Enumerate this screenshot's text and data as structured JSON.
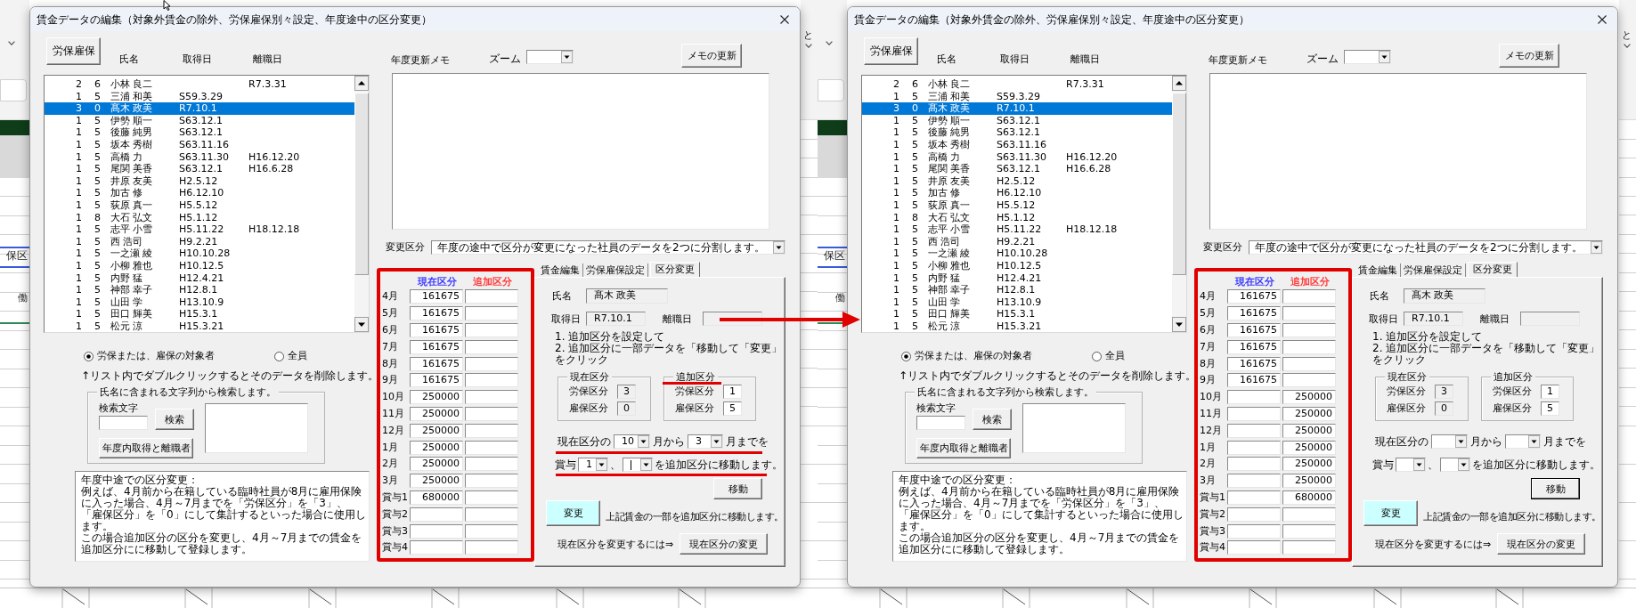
{
  "screenshots": [
    {
      "mouse_pointer": true,
      "background": {
        "left_texts": [
          "保区",
          "働"
        ],
        "right_texts": [
          "と"
        ]
      },
      "dialog": {
        "title": "賃金データの編集（対象外賃金の除外、労保雇保別々設定、年度途中の区分変更）",
        "insurance_button": "労保雇保",
        "list_columns": [
          "氏名",
          "取得日",
          "離職日"
        ],
        "employees": [
          {
            "column_1": "2",
            "column_2": "6",
            "name": "小林 良二",
            "left": "R7.3.31",
            "selected": false
          },
          {
            "column_1": "1",
            "column_2": "5",
            "name": "三浦 和美",
            "acquired": "S59.3.29",
            "selected": false
          },
          {
            "column_1": "3",
            "column_2": "0",
            "name": "髙木 政美",
            "acquired": "R7.10.1",
            "selected": true
          },
          {
            "column_1": "1",
            "column_2": "5",
            "name": "伊勢 順一",
            "acquired": "S63.12.1",
            "selected": false
          },
          {
            "column_1": "1",
            "column_2": "5",
            "name": "後藤 純男",
            "acquired": "S63.12.1",
            "selected": false
          },
          {
            "column_1": "1",
            "column_2": "5",
            "name": "坂本 秀樹",
            "acquired": "S63.11.16",
            "selected": false
          },
          {
            "column_1": "1",
            "column_2": "5",
            "name": "高橋 力",
            "acquired": "S63.11.30",
            "left": "H16.12.20",
            "selected": false
          },
          {
            "column_1": "1",
            "column_2": "5",
            "name": "尾関 美香",
            "acquired": "S63.12.1",
            "left": "H16.6.28",
            "selected": false
          },
          {
            "column_1": "1",
            "column_2": "5",
            "name": "井原 友美",
            "acquired": "H2.5.12",
            "selected": false
          },
          {
            "column_1": "1",
            "column_2": "5",
            "name": "加古 修",
            "acquired": "H6.12.10",
            "selected": false
          },
          {
            "column_1": "1",
            "column_2": "5",
            "name": "荻原 真一",
            "acquired": "H5.5.12",
            "selected": false
          },
          {
            "column_1": "1",
            "column_2": "8",
            "name": "大石 弘文",
            "acquired": "H5.1.12",
            "selected": false
          },
          {
            "column_1": "1",
            "column_2": "5",
            "name": "志平 小雪",
            "acquired": "H5.11.22",
            "left": "H18.12.18",
            "selected": false
          },
          {
            "column_1": "1",
            "column_2": "5",
            "name": "西 浩司",
            "acquired": "H9.2.21",
            "selected": false
          },
          {
            "column_1": "1",
            "column_2": "5",
            "name": "一之瀬 綾",
            "acquired": "H10.10.28",
            "selected": false
          },
          {
            "column_1": "1",
            "column_2": "5",
            "name": "小柳 雅也",
            "acquired": "H10.12.5",
            "selected": false
          },
          {
            "column_1": "1",
            "column_2": "5",
            "name": "内野 猛",
            "acquired": "H12.4.21",
            "selected": false
          },
          {
            "column_1": "1",
            "column_2": "5",
            "name": "神部 幸子",
            "acquired": "H12.8.1",
            "selected": false
          },
          {
            "column_1": "1",
            "column_2": "5",
            "name": "山田 学",
            "acquired": "H13.10.9",
            "selected": false
          },
          {
            "column_1": "1",
            "column_2": "5",
            "name": "田口 輝美",
            "acquired": "H15.3.1",
            "selected": false
          },
          {
            "column_1": "1",
            "column_2": "5",
            "name": "松元 涼",
            "acquired": "H15.3.21",
            "selected": false
          }
        ],
        "filter_options": [
          {
            "label": "労保または、雇保の対象者",
            "selected": true
          },
          {
            "label": "全員",
            "selected": false
          }
        ],
        "list_note": "↑リスト内でダブルクリックするとそのデータを削除します。",
        "search": {
          "title": "氏名に含まれる文字列から検索します。",
          "field_label": "検索文字",
          "search_button": "検索",
          "period_button": "年度内取得と離職者"
        },
        "explanation": [
          "年度中途での区分変更：",
          "例えば、4月前から在籍している臨時社員が8月に雇用保険に入った場合、4月～7月までを「労保区分」を「3」、「雇保区分」を「0」にして集計するといった場合に使用します。",
          "この場合追加区分の区分を変更し、4月～7月までの賃金を追加区分にに移動して登録します。"
        ],
        "memo_label": "年度更新メモ",
        "zoom_label": "ズーム",
        "memo_button": "メモの更新",
        "change_type": {
          "label": "変更区分",
          "value": "年度の途中で区分が変更になった社員のデータを2つに分割します。"
        },
        "month_table": {
          "highlighted": true,
          "columns": [
            {
              "label": "現在区分",
              "color": "#3c3cff"
            },
            {
              "label": "追加区分",
              "color": "#ff3c3c"
            }
          ],
          "rows": [
            {
              "label": "4月",
              "current": "161675"
            },
            {
              "label": "5月",
              "current": "161675"
            },
            {
              "label": "6月",
              "current": "161675"
            },
            {
              "label": "7月",
              "current": "161675"
            },
            {
              "label": "8月",
              "current": "161675"
            },
            {
              "label": "9月",
              "current": "161675"
            },
            {
              "label": "10月",
              "current": "250000"
            },
            {
              "label": "11月",
              "current": "250000"
            },
            {
              "label": "12月",
              "current": "250000"
            },
            {
              "label": "1月",
              "current": "250000"
            },
            {
              "label": "2月",
              "current": "250000"
            },
            {
              "label": "3月",
              "current": "250000"
            },
            {
              "label": "賞与1",
              "current": "680000"
            },
            {
              "label": "賞与2"
            },
            {
              "label": "賞与3"
            },
            {
              "label": "賞与4"
            }
          ]
        },
        "tabs": [
          {
            "label": "賃金編集",
            "selected": false
          },
          {
            "label": "労保雇保設定",
            "selected": false
          },
          {
            "label": "区分変更",
            "selected": true
          }
        ],
        "tab_page": {
          "name_field": {
            "label": "氏名",
            "value": "髙木 政美"
          },
          "acquired_field": {
            "label": "取得日",
            "value": "R7.10.1"
          },
          "left_field": {
            "label": "離職日"
          },
          "steps": [
            "1. 追加区分を設定して",
            "2. 追加区分に一部データを「移動して「変更」をクリック"
          ],
          "groups": [
            {
              "title": "現在区分",
              "underlined": false,
              "fields": [
                {
                  "label": "労保区分",
                  "value": "3",
                  "disabled": true
                },
                {
                  "label": "雇保区分",
                  "value": "0",
                  "disabled": true
                }
              ]
            },
            {
              "title": "追加区分",
              "underlined": true,
              "fields": [
                {
                  "label": "労保区分",
                  "value": "1",
                  "disabled": false
                },
                {
                  "label": "雇保区分",
                  "value": "5",
                  "disabled": false
                }
              ]
            }
          ],
          "range_row": {
            "underlined": true,
            "parts": [
              {
                "kind": "text",
                "text": "現在区分の"
              },
              {
                "kind": "combo",
                "value": "10",
                "focused": false
              },
              {
                "kind": "text",
                "text": "月から"
              },
              {
                "kind": "combo",
                "value": "3",
                "focused": false
              },
              {
                "kind": "text",
                "text": "月までを"
              }
            ]
          },
          "bonus_row": {
            "underlined": true,
            "parts": [
              {
                "kind": "text",
                "text": "賞与"
              },
              {
                "kind": "combo",
                "value": "1",
                "focused": false
              },
              {
                "kind": "text",
                "text": "、"
              },
              {
                "kind": "combo",
                "focused": true
              },
              {
                "kind": "text",
                "text": "を追加区分に移動します。"
              }
            ]
          },
          "move_button": {
            "label": "移動",
            "focused": false
          },
          "change_button": "変更",
          "change_note": "上記賃金の一部を追加区分に移動します。",
          "switch_note": "現在区分を変更するには⇒",
          "switch_button": "現在区分の変更"
        }
      }
    },
    {
      "background": {
        "left_texts": [
          "保区",
          "働"
        ],
        "right_texts": [
          "と"
        ]
      },
      "dialog": {
        "title": "賃金データの編集（対象外賃金の除外、労保雇保別々設定、年度途中の区分変更）",
        "insurance_button": "労保雇保",
        "list_columns": [
          "氏名",
          "取得日",
          "離職日"
        ],
        "employees": [
          {
            "column_1": "2",
            "column_2": "6",
            "name": "小林 良二",
            "left": "R7.3.31",
            "selected": false
          },
          {
            "column_1": "1",
            "column_2": "5",
            "name": "三浦 和美",
            "acquired": "S59.3.29",
            "selected": false
          },
          {
            "column_1": "3",
            "column_2": "0",
            "name": "髙木 政美",
            "acquired": "R7.10.1",
            "selected": true
          },
          {
            "column_1": "1",
            "column_2": "5",
            "name": "伊勢 順一",
            "acquired": "S63.12.1",
            "selected": false
          },
          {
            "column_1": "1",
            "column_2": "5",
            "name": "後藤 純男",
            "acquired": "S63.12.1",
            "selected": false
          },
          {
            "column_1": "1",
            "column_2": "5",
            "name": "坂本 秀樹",
            "acquired": "S63.11.16",
            "selected": false
          },
          {
            "column_1": "1",
            "column_2": "5",
            "name": "高橋 力",
            "acquired": "S63.11.30",
            "left": "H16.12.20",
            "selected": false
          },
          {
            "column_1": "1",
            "column_2": "5",
            "name": "尾関 美香",
            "acquired": "S63.12.1",
            "left": "H16.6.28",
            "selected": false
          },
          {
            "column_1": "1",
            "column_2": "5",
            "name": "井原 友美",
            "acquired": "H2.5.12",
            "selected": false
          },
          {
            "column_1": "1",
            "column_2": "5",
            "name": "加古 修",
            "acquired": "H6.12.10",
            "selected": false
          },
          {
            "column_1": "1",
            "column_2": "5",
            "name": "荻原 真一",
            "acquired": "H5.5.12",
            "selected": false
          },
          {
            "column_1": "1",
            "column_2": "8",
            "name": "大石 弘文",
            "acquired": "H5.1.12",
            "selected": false
          },
          {
            "column_1": "1",
            "column_2": "5",
            "name": "志平 小雪",
            "acquired": "H5.11.22",
            "left": "H18.12.18",
            "selected": false
          },
          {
            "column_1": "1",
            "column_2": "5",
            "name": "西 浩司",
            "acquired": "H9.2.21",
            "selected": false
          },
          {
            "column_1": "1",
            "column_2": "5",
            "name": "一之瀬 綾",
            "acquired": "H10.10.28",
            "selected": false
          },
          {
            "column_1": "1",
            "column_2": "5",
            "name": "小柳 雅也",
            "acquired": "H10.12.5",
            "selected": false
          },
          {
            "column_1": "1",
            "column_2": "5",
            "name": "内野 猛",
            "acquired": "H12.4.21",
            "selected": false
          },
          {
            "column_1": "1",
            "column_2": "5",
            "name": "神部 幸子",
            "acquired": "H12.8.1",
            "selected": false
          },
          {
            "column_1": "1",
            "column_2": "5",
            "name": "山田 学",
            "acquired": "H13.10.9",
            "selected": false
          },
          {
            "column_1": "1",
            "column_2": "5",
            "name": "田口 輝美",
            "acquired": "H15.3.1",
            "selected": false
          },
          {
            "column_1": "1",
            "column_2": "5",
            "name": "松元 涼",
            "acquired": "H15.3.21",
            "selected": false
          }
        ],
        "filter_options": [
          {
            "label": "労保または、雇保の対象者",
            "selected": true
          },
          {
            "label": "全員",
            "selected": false
          }
        ],
        "list_note": "↑リスト内でダブルクリックするとそのデータを削除します。",
        "search": {
          "title": "氏名に含まれる文字列から検索します。",
          "field_label": "検索文字",
          "search_button": "検索",
          "period_button": "年度内取得と離職者"
        },
        "explanation": [
          "年度中途での区分変更：",
          "例えば、4月前から在籍している臨時社員が8月に雇用保険に入った場合、4月～7月までを「労保区分」を「3」、「雇保区分」を「0」にして集計するといった場合に使用します。",
          "この場合追加区分の区分を変更し、4月～7月までの賃金を追加区分にに移動して登録します。"
        ],
        "memo_label": "年度更新メモ",
        "zoom_label": "ズーム",
        "memo_button": "メモの更新",
        "change_type": {
          "label": "変更区分",
          "value": "年度の途中で区分が変更になった社員のデータを2つに分割します。"
        },
        "month_table": {
          "highlighted": true,
          "columns": [
            {
              "label": "現在区分",
              "color": "#3c3cff"
            },
            {
              "label": "追加区分",
              "color": "#ff3c3c"
            }
          ],
          "rows": [
            {
              "label": "4月",
              "current": "161675"
            },
            {
              "label": "5月",
              "current": "161675"
            },
            {
              "label": "6月",
              "current": "161675"
            },
            {
              "label": "7月",
              "current": "161675"
            },
            {
              "label": "8月",
              "current": "161675"
            },
            {
              "label": "9月",
              "current": "161675"
            },
            {
              "label": "10月",
              "additional": "250000"
            },
            {
              "label": "11月",
              "additional": "250000"
            },
            {
              "label": "12月",
              "additional": "250000"
            },
            {
              "label": "1月",
              "additional": "250000"
            },
            {
              "label": "2月",
              "additional": "250000"
            },
            {
              "label": "3月",
              "additional": "250000"
            },
            {
              "label": "賞与1",
              "additional": "680000"
            },
            {
              "label": "賞与2"
            },
            {
              "label": "賞与3"
            },
            {
              "label": "賞与4"
            }
          ]
        },
        "tabs": [
          {
            "label": "賃金編集",
            "selected": false
          },
          {
            "label": "労保雇保設定",
            "selected": false
          },
          {
            "label": "区分変更",
            "selected": true
          }
        ],
        "tab_page": {
          "name_field": {
            "label": "氏名",
            "value": "髙木 政美"
          },
          "acquired_field": {
            "label": "取得日",
            "value": "R7.10.1"
          },
          "left_field": {
            "label": "離職日"
          },
          "steps": [
            "1. 追加区分を設定して",
            "2. 追加区分に一部データを「移動して「変更」をクリック"
          ],
          "groups": [
            {
              "title": "現在区分",
              "underlined": false,
              "fields": [
                {
                  "label": "労保区分",
                  "value": "3",
                  "disabled": true
                },
                {
                  "label": "雇保区分",
                  "value": "0",
                  "disabled": true
                }
              ]
            },
            {
              "title": "追加区分",
              "underlined": false,
              "fields": [
                {
                  "label": "労保区分",
                  "value": "1",
                  "disabled": false
                },
                {
                  "label": "雇保区分",
                  "value": "5",
                  "disabled": false
                }
              ]
            }
          ],
          "range_row": {
            "underlined": false,
            "parts": [
              {
                "kind": "text",
                "text": "現在区分の"
              },
              {
                "kind": "combo",
                "focused": false
              },
              {
                "kind": "text",
                "text": "月から"
              },
              {
                "kind": "combo",
                "focused": false
              },
              {
                "kind": "text",
                "text": "月までを"
              }
            ]
          },
          "bonus_row": {
            "underlined": false,
            "parts": [
              {
                "kind": "text",
                "text": "賞与"
              },
              {
                "kind": "combo",
                "focused": false
              },
              {
                "kind": "text",
                "text": "、"
              },
              {
                "kind": "combo",
                "focused": false
              },
              {
                "kind": "text",
                "text": "を追加区分に移動します。"
              }
            ]
          },
          "move_button": {
            "label": "移動",
            "focused": true
          },
          "change_button": "変更",
          "change_note": "上記賃金の一部を追加区分に移動します。",
          "switch_note": "現在区分を変更するには⇒",
          "switch_button": "現在区分の変更"
        }
      }
    }
  ],
  "annotations": [
    {
      "kind": "arrow"
    }
  ]
}
